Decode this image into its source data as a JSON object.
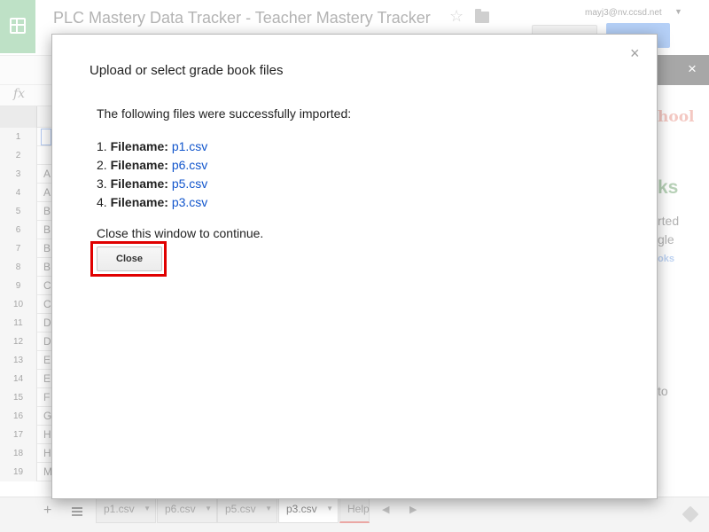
{
  "app": {
    "title": "PLC Mastery Data Tracker - Teacher Mastery Tracker",
    "user_email": "mayj3@nv.ccsd.net"
  },
  "formula_bar": {
    "fx_label": "fx"
  },
  "grid": {
    "rows": [
      {
        "num": "1",
        "cell": ""
      },
      {
        "num": "2",
        "cell": ""
      },
      {
        "num": "3",
        "cell": "A"
      },
      {
        "num": "4",
        "cell": "A"
      },
      {
        "num": "5",
        "cell": "B"
      },
      {
        "num": "6",
        "cell": "B"
      },
      {
        "num": "7",
        "cell": "B"
      },
      {
        "num": "8",
        "cell": "B"
      },
      {
        "num": "9",
        "cell": "C"
      },
      {
        "num": "10",
        "cell": "C"
      },
      {
        "num": "11",
        "cell": "D"
      },
      {
        "num": "12",
        "cell": "D"
      },
      {
        "num": "13",
        "cell": "E"
      },
      {
        "num": "14",
        "cell": "E"
      },
      {
        "num": "15",
        "cell": "F"
      },
      {
        "num": "16",
        "cell": "G"
      },
      {
        "num": "17",
        "cell": "H"
      },
      {
        "num": "18",
        "cell": "H"
      },
      {
        "num": "19",
        "cell": "M"
      }
    ]
  },
  "side_panel": {
    "close_glyph": "×",
    "fragments": [
      "hool",
      "ks",
      "rted",
      "gle",
      "oks",
      "to"
    ]
  },
  "sheet_tabs": [
    {
      "label": "p1.csv"
    },
    {
      "label": "p6.csv"
    },
    {
      "label": "p5.csv"
    },
    {
      "label": "p3.csv"
    },
    {
      "label": "Help"
    }
  ],
  "dialog": {
    "title": "Upload or select grade book files",
    "close_glyph": "×",
    "intro": "The following files were successfully imported:",
    "files": [
      {
        "number": "1.",
        "label": "Filename:",
        "name": "p1.csv"
      },
      {
        "number": "2.",
        "label": "Filename:",
        "name": "p6.csv"
      },
      {
        "number": "3.",
        "label": "Filename:",
        "name": "p5.csv"
      },
      {
        "number": "4.",
        "label": "Filename:",
        "name": "p3.csv"
      }
    ],
    "close_message": "Close this window to continue.",
    "close_button": "Close"
  },
  "colors": {
    "link": "#1155cc",
    "highlight": "#e00000",
    "sheets_green": "#a8d7b3"
  }
}
